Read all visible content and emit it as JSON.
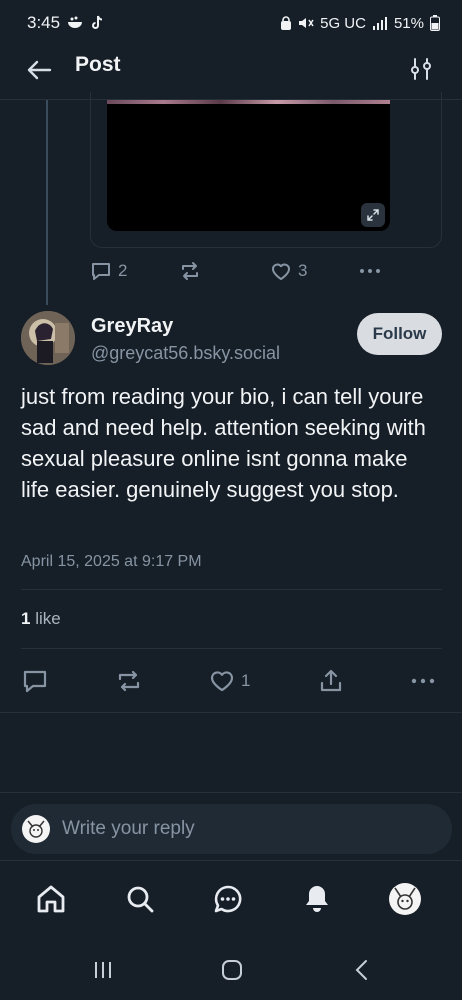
{
  "status_bar": {
    "time": "3:45",
    "network": "5G UC",
    "battery": "51%"
  },
  "header": {
    "title": "Post"
  },
  "parent_post": {
    "reply_count": "2",
    "like_count": "3"
  },
  "post": {
    "display_name": "GreyRay",
    "handle": "@greycat56.bsky.social",
    "follow_label": "Follow",
    "text": "just from reading your bio, i can tell youre sad and need help. attention seeking with sexual pleasure online isnt gonna make life easier. genuinely suggest you stop.",
    "date": "April 15, 2025 at 9:17 PM",
    "likes_count": "1",
    "likes_label": "like",
    "like_action_count": "1"
  },
  "reply": {
    "placeholder": "Write your reply"
  },
  "bottom_nav": [
    "home-icon",
    "search-icon",
    "chat-icon",
    "bell-icon",
    "profile-avatar"
  ],
  "colors": {
    "background": "#161e27",
    "muted": "#8794a3",
    "follow_bg": "#d9dde2",
    "reply_bg": "#202a35"
  }
}
